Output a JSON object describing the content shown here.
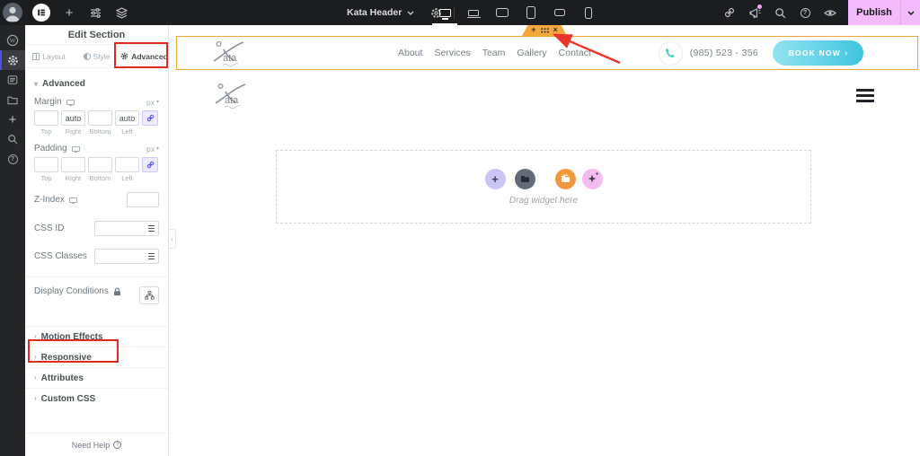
{
  "icons": {
    "plus": "+",
    "close": "×",
    "caret_down": "▾",
    "caret_right": "›",
    "caret_left": "‹",
    "help": "?"
  },
  "topbar": {
    "document_name": "Kata Header",
    "publish_label": "Publish"
  },
  "panel": {
    "title": "Edit Section",
    "tabs": [
      {
        "label": "Layout"
      },
      {
        "label": "Style"
      },
      {
        "label": "Advanced"
      }
    ],
    "advanced_section_label": "Advanced",
    "margin": {
      "label": "Margin",
      "unit": "px",
      "top": "",
      "right": "auto",
      "bottom": "",
      "left": "auto"
    },
    "padding": {
      "label": "Padding",
      "unit": "px",
      "top": "",
      "right": "",
      "bottom": "",
      "left": ""
    },
    "dim_labels": [
      "Top",
      "Right",
      "Bottom",
      "Left"
    ],
    "z_index_label": "Z-Index",
    "css_id_label": "CSS ID",
    "css_classes_label": "CSS Classes",
    "display_conditions_label": "Display Conditions",
    "collapsed_sections": [
      "Motion Effects",
      "Responsive",
      "Attributes",
      "Custom CSS"
    ],
    "need_help_label": "Need Help"
  },
  "preview": {
    "logo": {
      "name": "Kata",
      "text_part": "ata"
    },
    "nav": [
      "About",
      "Services",
      "Team",
      "Gallery",
      "Contact"
    ],
    "phone_number": "(985) 523 - 356",
    "book_now_label": "BOOK NOW",
    "drag_hint": "Drag widget here"
  },
  "colors": {
    "accent_orange": "#F2A43C",
    "publish_pink": "#F3BAFD",
    "annotation_red": "#E02A20",
    "book_gradient_start": "#92E4F1",
    "book_gradient_end": "#3FC5E0",
    "phone_teal": "#3FD3BE",
    "link_purple": "#524CFF"
  }
}
